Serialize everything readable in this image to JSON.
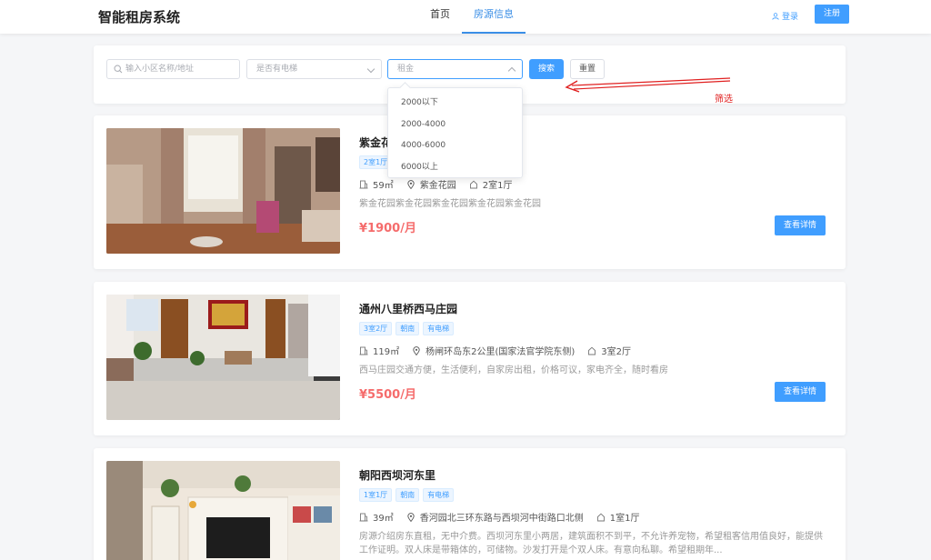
{
  "header": {
    "logo": "智能租房系统",
    "nav": [
      {
        "label": "首页",
        "active": false
      },
      {
        "label": "房源信息",
        "active": true
      }
    ],
    "login": "登录",
    "register": "注册"
  },
  "filters": {
    "search_placeholder": "输入小区名称/地址",
    "elevator_placeholder": "是否有电梯",
    "rent_placeholder": "租金",
    "search_button": "搜索",
    "reset_button": "重置",
    "rent_options": [
      "2000以下",
      "2000-4000",
      "4000-6000",
      "6000以上"
    ]
  },
  "annotation": {
    "label": "筛选",
    "color": "#e02020"
  },
  "listings": [
    {
      "title": "紫金花园",
      "tags": [
        "2室1厅"
      ],
      "area": "59㎡",
      "location": "紫金花园",
      "layout": "2室1厅",
      "description": "紫金花园紫金花园紫金花园紫金花园紫金花园",
      "price": "¥1900/月",
      "detail_button": "查看详情"
    },
    {
      "title": "通州八里桥西马庄园",
      "tags": [
        "3室2厅",
        "朝南",
        "有电梯"
      ],
      "area": "119㎡",
      "location": "杨闸环岛东2公里(国家法官学院东侧)",
      "layout": "3室2厅",
      "description": "西马庄园交通方便，生活便利，自家房出租，价格可议，家电齐全，随时看房",
      "price": "¥5500/月",
      "detail_button": "查看详情"
    },
    {
      "title": "朝阳西坝河东里",
      "tags": [
        "1室1厅",
        "朝南",
        "有电梯"
      ],
      "area": "39㎡",
      "location": "香河园北三环东路与西坝河中街路口北侧",
      "layout": "1室1厅",
      "description": "房源介绍房东直租，无中介费。西坝河东里小两居，建筑面积不到平，不允许养宠物，希望租客信用值良好，能提供工作证明。双人床是带箱体的，可储物。沙发打开是个双人床。有意向私聊。希望租期年...",
      "price": "",
      "detail_button": ""
    }
  ],
  "colors": {
    "primary": "#409eff",
    "price": "#f56c6c",
    "annotation": "#e02020"
  }
}
